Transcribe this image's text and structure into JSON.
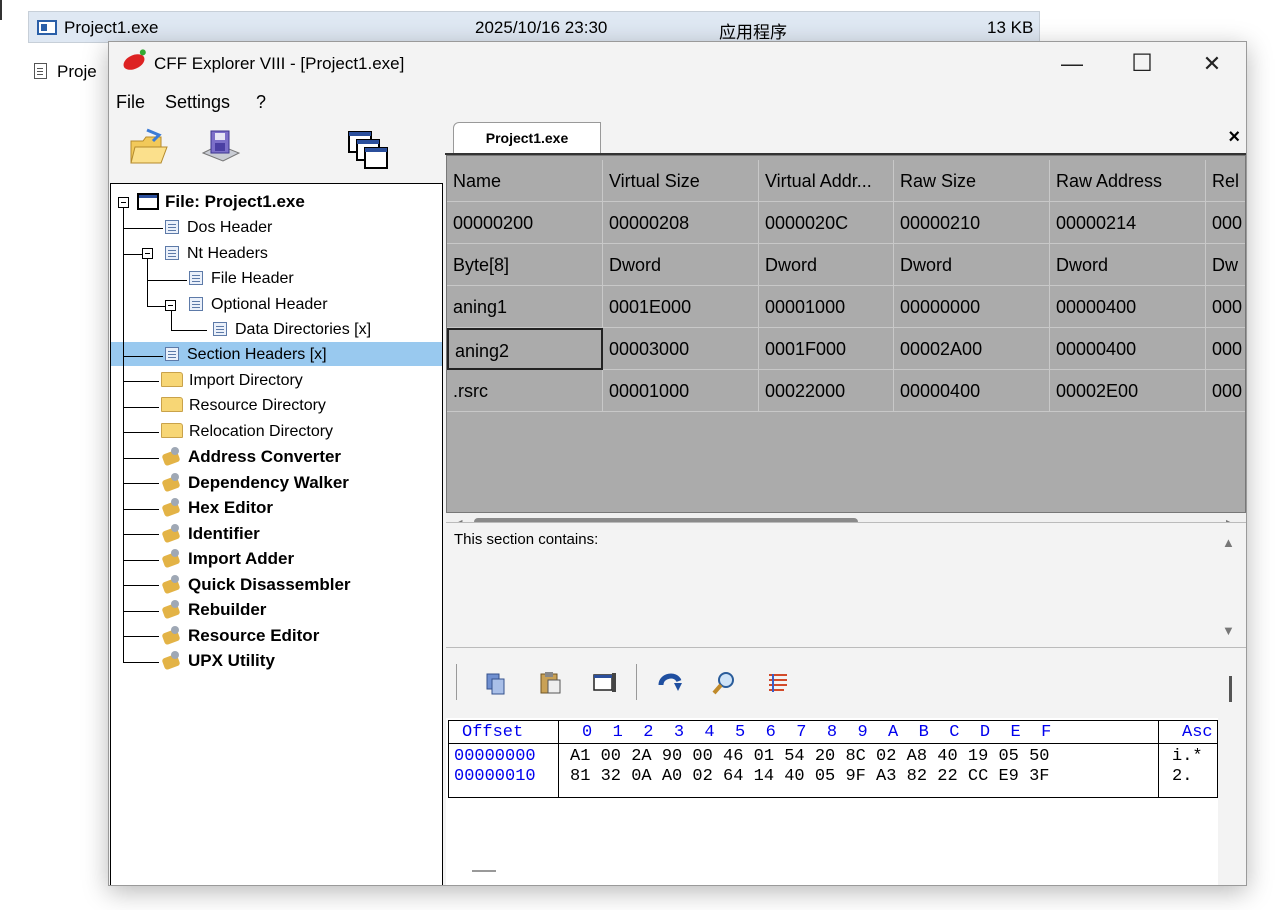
{
  "explorer": {
    "file_name": "Project1.exe",
    "date": "2025/10/16 23:30",
    "type": "应用程序",
    "size": "13 KB",
    "second_row": "Proje"
  },
  "window": {
    "title": "CFF Explorer VIII - [Project1.exe]",
    "minimize": "—",
    "maximize": "☐",
    "close": "✕"
  },
  "menu": {
    "file": "File",
    "settings": "Settings",
    "help": "?"
  },
  "tab": {
    "label": "Project1.exe",
    "close": "×"
  },
  "tree": {
    "root": "File: Project1.exe",
    "dos_header": "Dos Header",
    "nt_headers": "Nt Headers",
    "file_header": "File Header",
    "optional_header": "Optional Header",
    "data_directories": "Data Directories [x]",
    "section_headers": "Section Headers [x]",
    "import_directory": "Import Directory",
    "resource_directory": "Resource Directory",
    "relocation_directory": "Relocation Directory",
    "tools": [
      "Address Converter",
      "Dependency Walker",
      "Hex Editor",
      "Identifier",
      "Import Adder",
      "Quick Disassembler",
      "Rebuilder",
      "Resource Editor",
      "UPX Utility"
    ]
  },
  "grid": {
    "columns": [
      "Name",
      "Virtual Size",
      "Virtual Addr...",
      "Raw Size",
      "Raw Address",
      "Rel"
    ],
    "offsets": [
      "00000200",
      "00000208",
      "0000020C",
      "00000210",
      "00000214",
      "000"
    ],
    "types": [
      "Byte[8]",
      "Dword",
      "Dword",
      "Dword",
      "Dword",
      "Dw"
    ],
    "rows": [
      [
        "aning1",
        "0001E000",
        "00001000",
        "00000000",
        "00000400",
        "000"
      ],
      [
        "aning2",
        "00003000",
        "0001F000",
        "00002A00",
        "00000400",
        "000"
      ],
      [
        ".rsrc",
        "00001000",
        "00022000",
        "00000400",
        "00002E00",
        "000"
      ]
    ],
    "selected_row": 1
  },
  "info": {
    "text": "This section contains:"
  },
  "hex": {
    "header_offset": "Offset",
    "header_cols": "0  1  2  3  4  5  6  7  8  9  A  B  C  D  E  F",
    "header_ascii": "Asc",
    "lines": [
      {
        "offset": "00000000",
        "bytes": "A1 00 2A 90 00 46 01 54 20 8C 02 A8 40 19 05 50",
        "ascii": "i.*"
      },
      {
        "offset": "00000010",
        "bytes": "81 32 0A A0 02 64 14 40 05 9F A3 82 22 CC E9 3F",
        "ascii": "2."
      }
    ]
  },
  "colors": {
    "selection": "#99c9ef",
    "row_selected": "#b5c8e8",
    "offset_blue": "#0000ee"
  }
}
